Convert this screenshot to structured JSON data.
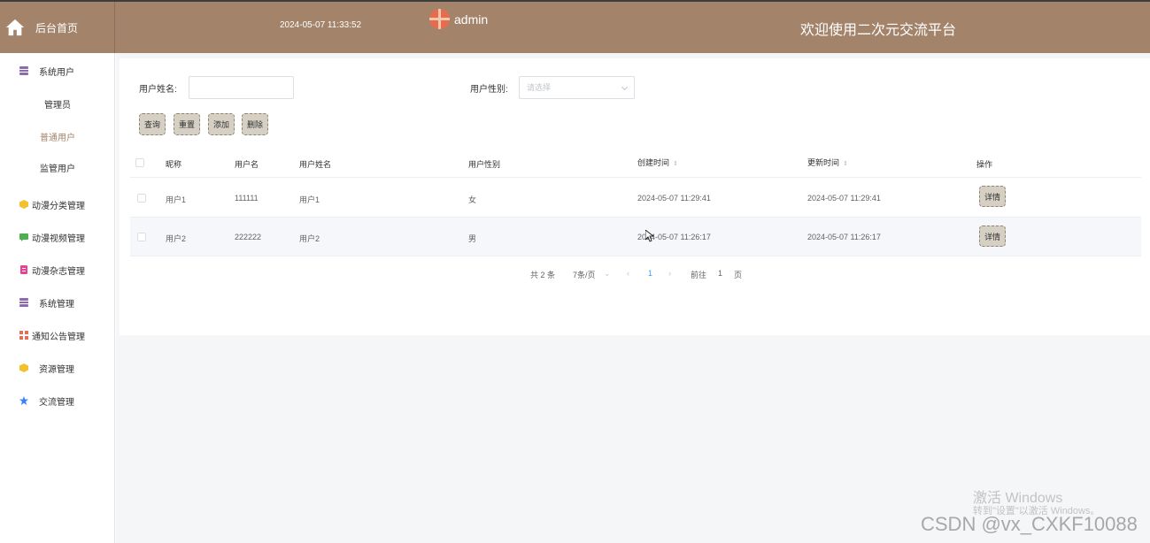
{
  "header": {
    "home_label": "后台首页",
    "time": "2024-05-07 11:33:52",
    "admin": "admin",
    "welcome": "欢迎使用二次元交流平台",
    "bg_color": "#a3846b"
  },
  "sidebar": {
    "items": [
      {
        "label": "系统用户",
        "icon": "database-icon",
        "color": "#8c6bb1"
      },
      {
        "label": "管理员"
      },
      {
        "label": "普通用户",
        "active": true
      },
      {
        "label": "监管用户"
      },
      {
        "label": "动漫分类管理",
        "icon": "cube-icon",
        "color": "#f2c12e"
      },
      {
        "label": "动漫视频管理",
        "icon": "message-icon",
        "color": "#4caf50"
      },
      {
        "label": "动漫杂志管理",
        "icon": "document-icon",
        "color": "#e84393"
      },
      {
        "label": "系统管理",
        "icon": "database-icon",
        "color": "#8c6bb1"
      },
      {
        "label": "通知公告管理",
        "icon": "grid-icon",
        "color": "#e17055"
      },
      {
        "label": "资源管理",
        "icon": "cube-icon",
        "color": "#f2c12e"
      },
      {
        "label": "交流管理",
        "icon": "star-icon",
        "color": "#3b82f6"
      }
    ]
  },
  "search": {
    "name_label": "用户姓名:",
    "name_value": "",
    "gender_label": "用户性别:",
    "gender_placeholder": "请选择"
  },
  "buttons": {
    "query": "查询",
    "reset": "重置",
    "add": "添加",
    "delete": "删除"
  },
  "table": {
    "headers": [
      "昵称",
      "用户名",
      "用户姓名",
      "用户性别",
      "创建时间",
      "更新时间",
      "操作"
    ],
    "rows": [
      {
        "nickname": "用户1",
        "username": "111111",
        "realname": "用户1",
        "gender": "女",
        "created": "2024-05-07 11:29:41",
        "updated": "2024-05-07 11:29:41",
        "action": "详情"
      },
      {
        "nickname": "用户2",
        "username": "222222",
        "realname": "用户2",
        "gender": "男",
        "created": "2024-05-07 11:26:17",
        "updated": "2024-05-07 11:26:17",
        "action": "详情"
      }
    ]
  },
  "pagination": {
    "total": "共 2 条",
    "page_size": "7条/页",
    "current": "1",
    "goto_label": "前往",
    "goto_value": "1",
    "page_suffix": "页"
  },
  "overlay": {
    "activate_title": "激活 Windows",
    "activate_sub": "转到\"设置\"以激活 Windows。",
    "watermark": "CSDN @vx_CXKF10088"
  }
}
